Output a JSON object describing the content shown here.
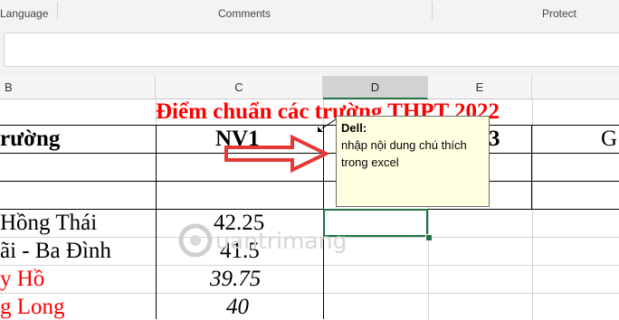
{
  "ribbon": {
    "groups": [
      "Language",
      "Comments",
      "Protect"
    ]
  },
  "columns": [
    "B",
    "C",
    "D",
    "E"
  ],
  "sheet": {
    "title": "Điểm chuẩn các trường THPT 2022",
    "header_b": "rường",
    "header_c": "NV1",
    "header_e": "3",
    "header_f": "G",
    "rows": [
      {
        "school": "Hồng Thái",
        "score": "42.25"
      },
      {
        "school": "ãi - Ba Đình",
        "score": "41.5"
      },
      {
        "school": "y Hồ",
        "score": "39.75"
      },
      {
        "school": "g Long",
        "score": "40"
      }
    ]
  },
  "comment": {
    "author": "Dell:",
    "text": "nhập nội dung chú thích trong excel"
  },
  "watermark": {
    "text": "uantrimang"
  },
  "colors": {
    "title": "#ff0000",
    "red_rows": "#ff0000",
    "selection": "#217346",
    "comment_bg": "#ffffe1",
    "arrow": "#e53935"
  }
}
